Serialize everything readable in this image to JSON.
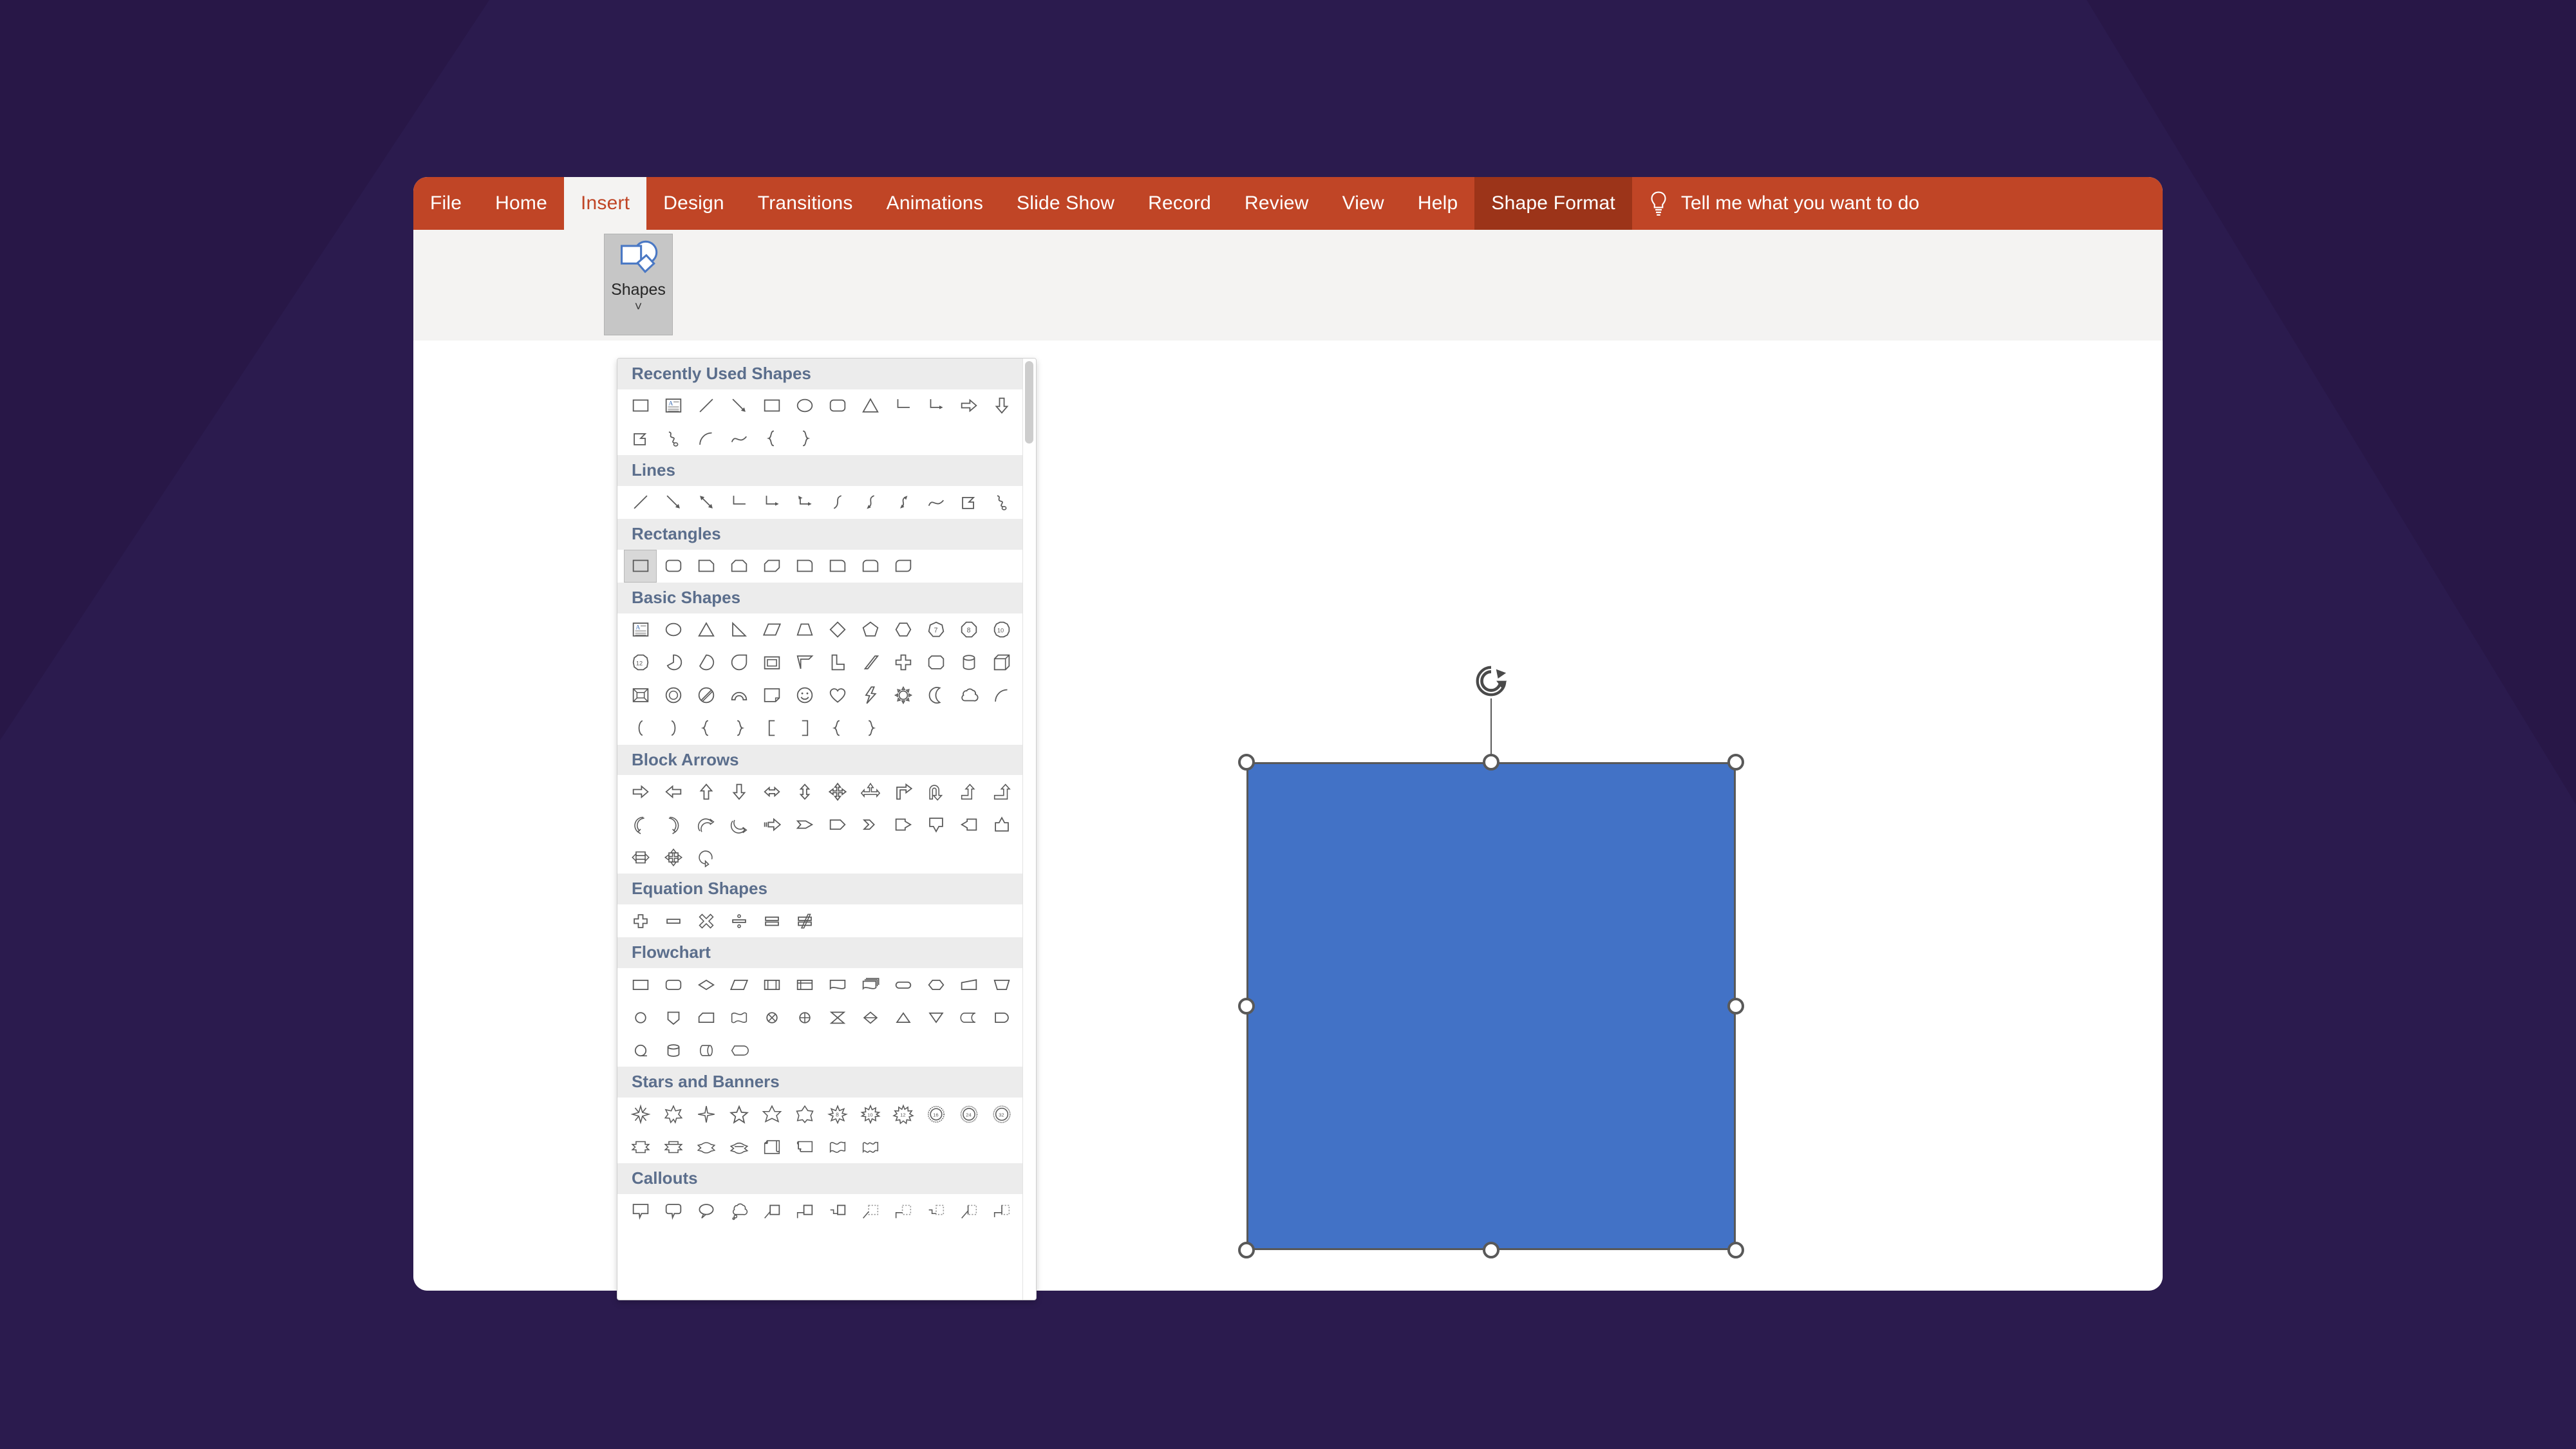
{
  "theme": {
    "backdrop": "#2b1b4e",
    "ribbon_orange": "#c04526",
    "context_tab": "#9c3419",
    "shape_fill": "#4472c4",
    "shape_outline": "#585858",
    "category_header_text": "#5b6e8c"
  },
  "ribbon": {
    "tabs": [
      {
        "label": "File",
        "state": "normal"
      },
      {
        "label": "Home",
        "state": "normal"
      },
      {
        "label": "Insert",
        "state": "active"
      },
      {
        "label": "Design",
        "state": "normal"
      },
      {
        "label": "Transitions",
        "state": "normal"
      },
      {
        "label": "Animations",
        "state": "normal"
      },
      {
        "label": "Slide Show",
        "state": "normal"
      },
      {
        "label": "Record",
        "state": "normal"
      },
      {
        "label": "Review",
        "state": "normal"
      },
      {
        "label": "View",
        "state": "normal"
      },
      {
        "label": "Help",
        "state": "normal"
      },
      {
        "label": "Shape Format",
        "state": "context"
      }
    ],
    "tell_me": {
      "icon": "lightbulb-icon",
      "label": "Tell me what you want to do"
    }
  },
  "ribbon_body": {
    "shapes_button": {
      "label": "Shapes",
      "icon": "shapes-icon",
      "caret": "˅",
      "state": "pressed"
    }
  },
  "shapes_gallery": {
    "visible": true,
    "scrollbar": {
      "thumb_position": "top"
    },
    "categories": [
      {
        "name": "Recently Used Shapes",
        "shapes": [
          "rectangle",
          "text-box",
          "line",
          "line-arrow",
          "rectangle",
          "oval",
          "rounded-rectangle",
          "isosceles-triangle",
          "elbow-connector",
          "elbow-arrow-connector",
          "right-arrow",
          "down-arrow",
          "freeform-shape",
          "scribble",
          "arc",
          "curve",
          "left-brace",
          "right-brace"
        ]
      },
      {
        "name": "Lines",
        "shapes": [
          "line",
          "line-arrow",
          "line-double-arrow",
          "elbow-connector",
          "elbow-arrow-connector",
          "elbow-double-arrow-connector",
          "curved-connector",
          "curved-arrow-connector",
          "curved-double-arrow-connector",
          "curve",
          "freeform-shape",
          "scribble"
        ]
      },
      {
        "name": "Rectangles",
        "shapes": [
          "rectangle",
          "rounded-rectangle",
          "snip-single-corner-rectangle",
          "snip-same-side-corner-rectangle",
          "snip-diagonal-corner-rectangle",
          "snip-and-round-single-corner-rectangle",
          "round-single-corner-rectangle",
          "round-same-side-corner-rectangle",
          "round-diagonal-corner-rectangle"
        ]
      },
      {
        "name": "Basic Shapes",
        "shapes": [
          "text-box",
          "oval",
          "isosceles-triangle",
          "right-triangle",
          "parallelogram",
          "trapezoid",
          "diamond",
          "pentagon",
          "hexagon",
          "heptagon",
          "octagon",
          "decagon",
          "dodecagon",
          "pie",
          "chord",
          "teardrop",
          "frame",
          "half-frame",
          "l-shape",
          "diagonal-stripe",
          "cross",
          "regular-pentagon-cut",
          "cylinder",
          "cube",
          "bevel",
          "donut",
          "no-symbol",
          "block-arc",
          "folded-corner",
          "smiley-face",
          "heart",
          "lightning-bolt",
          "sun",
          "moon",
          "cloud",
          "arc",
          "left-bracket",
          "right-bracket",
          "left-brace-pair",
          "right-brace-pair",
          "left-bracket-2",
          "right-bracket-2",
          "left-brace",
          "right-brace"
        ]
      },
      {
        "name": "Block Arrows",
        "shapes": [
          "right-arrow",
          "left-arrow",
          "up-arrow",
          "down-arrow",
          "left-right-arrow",
          "up-down-arrow",
          "four-way-arrow",
          "quad-arrow-partial",
          "bent-arrow",
          "u-turn-arrow",
          "left-up-arrow",
          "bent-up-arrow",
          "curved-left-arrow",
          "curved-right-arrow",
          "curved-up-arrow",
          "curved-down-arrow",
          "striped-right-arrow",
          "notched-right-arrow",
          "pentagon-arrow",
          "chevron",
          "right-arrow-callout",
          "down-arrow-callout",
          "left-arrow-callout",
          "up-arrow-callout",
          "left-right-arrow-callout",
          "quad-arrow-callout",
          "circular-arrow"
        ]
      },
      {
        "name": "Equation Shapes",
        "shapes": [
          "plus",
          "minus",
          "multiply",
          "divide",
          "equal",
          "not-equal"
        ]
      },
      {
        "name": "Flowchart",
        "shapes": [
          "flowchart-process",
          "flowchart-alternate-process",
          "flowchart-decision",
          "flowchart-data",
          "flowchart-predefined-process",
          "flowchart-internal-storage",
          "flowchart-document",
          "flowchart-multidocument",
          "flowchart-terminator",
          "flowchart-preparation",
          "flowchart-manual-input",
          "flowchart-manual-operation",
          "flowchart-connector",
          "flowchart-offpage-connector",
          "flowchart-card",
          "flowchart-punched-tape",
          "flowchart-summing-junction",
          "flowchart-or",
          "flowchart-collate",
          "flowchart-sort",
          "flowchart-extract",
          "flowchart-merge",
          "flowchart-stored-data",
          "flowchart-delay",
          "flowchart-sequential-access",
          "flowchart-magnetic-disk",
          "flowchart-direct-access-storage",
          "flowchart-display"
        ]
      },
      {
        "name": "Stars and Banners",
        "shapes": [
          "star-4-point",
          "star-5-point-burst",
          "star-4-point-thin",
          "star-5-point",
          "star-6-point",
          "star-7-point",
          "star-8-point",
          "star-10-point",
          "star-12-point",
          "star-16-point",
          "star-24-point",
          "star-32-point",
          "up-ribbon",
          "down-ribbon",
          "curved-up-ribbon",
          "curved-down-ribbon",
          "vertical-scroll",
          "horizontal-scroll",
          "wave",
          "double-wave"
        ]
      },
      {
        "name": "Callouts",
        "shapes": [
          "rectangular-callout",
          "rounded-rectangular-callout",
          "oval-callout",
          "cloud-callout",
          "line-callout-1",
          "line-callout-2",
          "line-callout-3",
          "line-callout-1-border",
          "line-callout-2-border",
          "line-callout-3-border",
          "line-callout-accent-1",
          "line-callout-accent-2"
        ]
      }
    ]
  },
  "slide": {
    "selected_shape": {
      "name": "rectangle",
      "fill": "#4472c4",
      "outline": "#585858",
      "handles": [
        "top-left",
        "top-center",
        "top-right",
        "middle-left",
        "middle-right",
        "bottom-left",
        "bottom-center",
        "bottom-right"
      ],
      "rotation_handle": "rotate-handle"
    }
  }
}
